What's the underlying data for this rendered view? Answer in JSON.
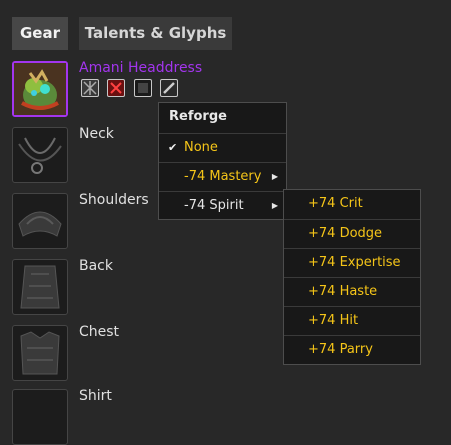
{
  "tabs": [
    {
      "label": "Gear"
    },
    {
      "label": "Talents & Glyphs"
    }
  ],
  "slots": [
    {
      "label": "Amani Headdress",
      "quality_color": "#a335ee"
    },
    {
      "label": "Neck"
    },
    {
      "label": "Shoulders"
    },
    {
      "label": "Back"
    },
    {
      "label": "Chest"
    },
    {
      "label": "Shirt"
    }
  ],
  "reforge_menu": {
    "title": "Reforge",
    "items": [
      {
        "label": "None",
        "checked": true
      },
      {
        "label": "-74 Mastery",
        "has_submenu": true
      },
      {
        "label": "-74 Spirit",
        "has_submenu": true
      }
    ],
    "check_icon": "checkmark-icon",
    "arrow_icon": "triangle-right-icon"
  },
  "spirit_submenu": {
    "items": [
      {
        "label": "+74 Crit"
      },
      {
        "label": "+74 Dodge"
      },
      {
        "label": "+74 Expertise"
      },
      {
        "label": "+74 Haste"
      },
      {
        "label": "+74 Hit"
      },
      {
        "label": "+74 Parry"
      }
    ]
  },
  "colors": {
    "epic": "#a335ee",
    "menu_text": "#f5c518"
  }
}
